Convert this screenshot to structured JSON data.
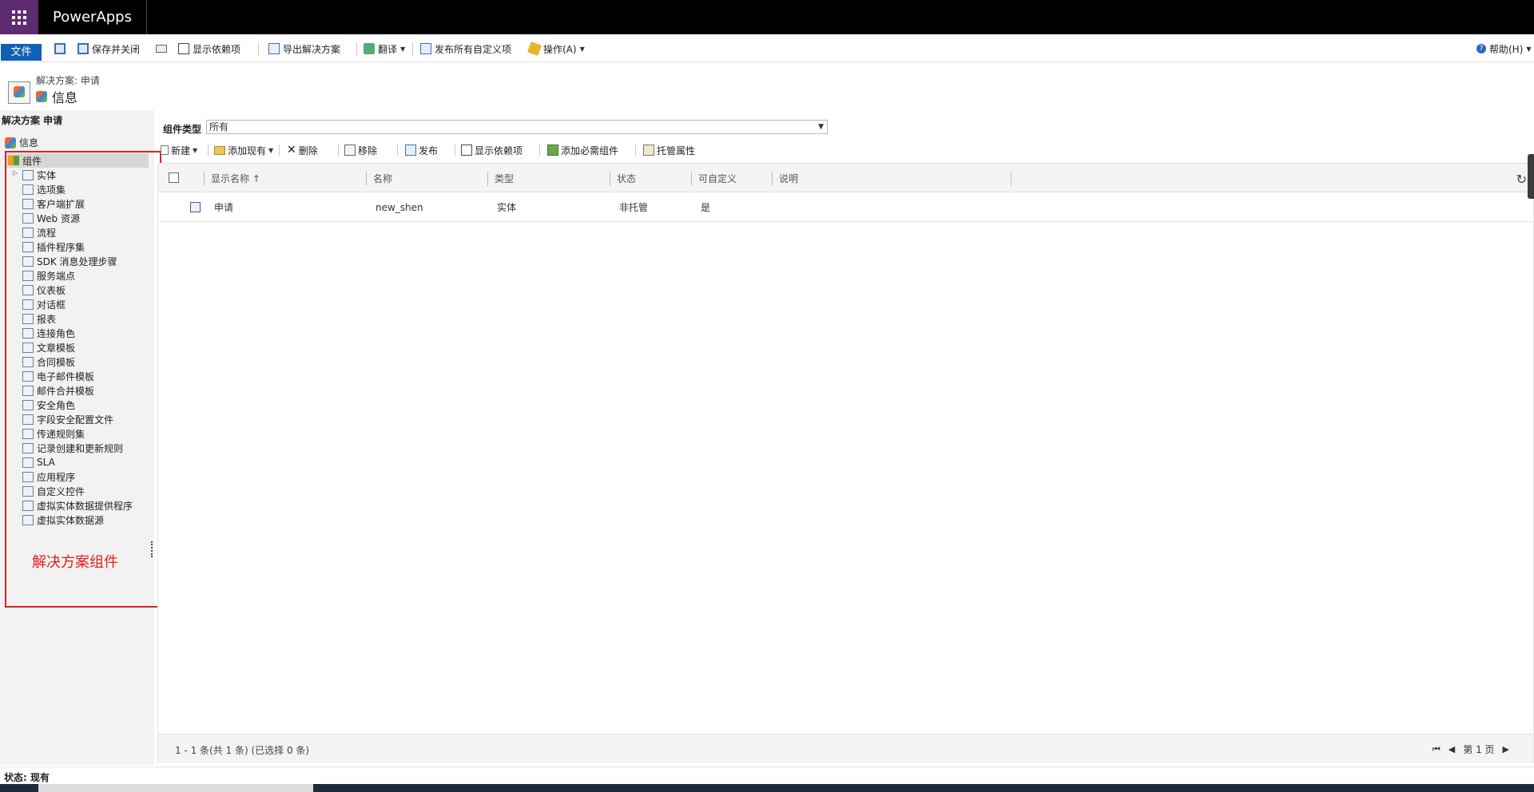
{
  "app": {
    "title": "PowerApps"
  },
  "ribbon": {
    "file": "文件",
    "save_close": "保存并关闭",
    "show_dependencies": "显示依赖项",
    "export_solution": "导出解决方案",
    "translate": "翻译",
    "publish_all": "发布所有自定义项",
    "actions": "操作(A)",
    "help": "帮助(H)"
  },
  "header": {
    "breadcrumb": "解决方案: 申请",
    "title": "信息"
  },
  "leftnav": {
    "title": "解决方案 申请",
    "info": "信息",
    "components": "组件",
    "items": [
      "实体",
      "选项集",
      "客户端扩展",
      "Web 资源",
      "流程",
      "插件程序集",
      "SDK 消息处理步骤",
      "服务端点",
      "仪表板",
      "对话框",
      "报表",
      "连接角色",
      "文章模板",
      "合同模板",
      "电子邮件模板",
      "邮件合并模板",
      "安全角色",
      "字段安全配置文件",
      "传递规则集",
      "记录创建和更新规则",
      "SLA",
      "应用程序",
      "自定义控件",
      "虚拟实体数据提供程序",
      "虚拟实体数据源"
    ],
    "annotation": "解决方案组件"
  },
  "filter": {
    "label": "组件类型",
    "value": "所有"
  },
  "grid_toolbar": {
    "new": "新建",
    "add_existing": "添加现有",
    "delete": "删除",
    "remove": "移除",
    "publish": "发布",
    "show_dependencies": "显示依赖项",
    "add_required": "添加必需组件",
    "managed_props": "托管属性"
  },
  "grid": {
    "columns": [
      "显示名称 ↑",
      "名称",
      "类型",
      "状态",
      "可自定义",
      "说明"
    ],
    "rows": [
      {
        "display_name": "申请",
        "name": "new_shen",
        "type": "实体",
        "state": "非托管",
        "customizable": "是"
      }
    ],
    "footer_count": "1 - 1 条(共 1 条) (已选择 0 条)",
    "page": "第 1 页"
  },
  "status": {
    "text": "状态: 现有"
  }
}
